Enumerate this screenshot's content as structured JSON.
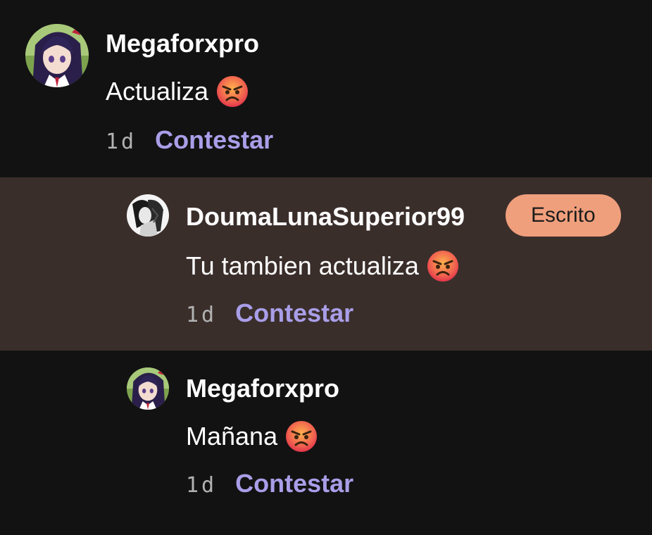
{
  "comments": [
    {
      "username": "Megaforxpro",
      "text": "Actualiza",
      "emoji": "angry-face-icon",
      "time": "1d",
      "reply_label": "Contestar"
    },
    {
      "username": "DoumaLunaSuperior99",
      "badge": "Escrito",
      "text": "Tu tambien actualiza",
      "emoji": "angry-face-icon",
      "time": "1d",
      "reply_label": "Contestar"
    },
    {
      "username": "Megaforxpro",
      "text": "Mañana",
      "emoji": "angry-face-icon",
      "time": "1d",
      "reply_label": "Contestar"
    }
  ],
  "colors": {
    "background": "#121212",
    "highlight_background": "#3a2e2b",
    "reply_link": "#a99ee8",
    "badge": "#f09f7c",
    "timestamp": "#b3b3b3"
  }
}
